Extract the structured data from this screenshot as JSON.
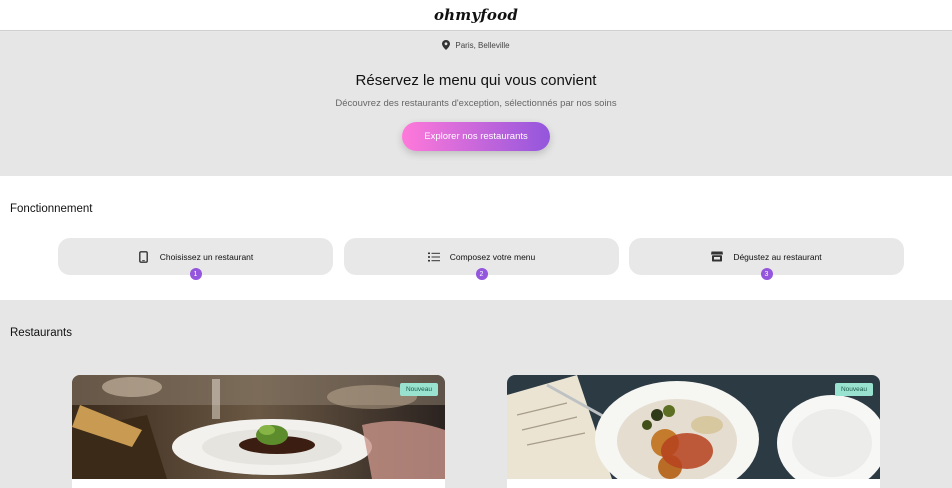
{
  "header": {
    "logo": "ohmyfood"
  },
  "hero": {
    "location": "Paris, Belleville",
    "title": "Réservez le menu qui vous convient",
    "subtitle": "Découvrez des restaurants d'exception, sélectionnés par nos soins",
    "cta_label": "Explorer nos restaurants",
    "colors": {
      "cta_start": "#ff79da",
      "cta_end": "#9356dc"
    }
  },
  "how": {
    "title": "Fonctionnement",
    "steps": [
      {
        "number": "1",
        "label": "Choisissez un restaurant",
        "icon": "mobile-phone-icon"
      },
      {
        "number": "2",
        "label": "Composez votre menu",
        "icon": "list-icon"
      },
      {
        "number": "3",
        "label": "Dégustez au restaurant",
        "icon": "store-icon"
      }
    ]
  },
  "restaurants": {
    "title": "Restaurants",
    "cards": [
      {
        "badge": "Nouveau",
        "image": "plated-dish-photo"
      },
      {
        "badge": "Nouveau",
        "image": "tapas-plate-photo"
      }
    ]
  }
}
